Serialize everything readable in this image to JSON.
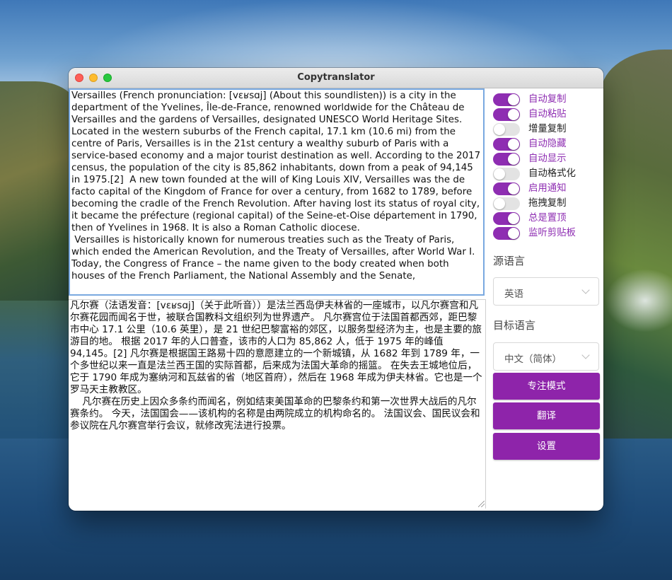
{
  "window": {
    "title": "Copytranslator"
  },
  "source_text": "Versailles (French pronunciation: [vɛʁsɑj] (About this soundlisten)) is a city in the department of the Yvelines, Île-de-France, renowned worldwide for the Château de Versailles and the gardens of Versailles, designated UNESCO World Heritage Sites. Located in the western suburbs of the French capital, 17.1 km (10.6 mi) from the centre of Paris, Versailles is in the 21st century a wealthy suburb of Paris with a service-based economy and a major tourist destination as well. According to the 2017 census, the population of the city is 85,862 inhabitants, down from a peak of 94,145 in 1975.[2]  A new town founded at the will of King Louis XIV, Versailles was the de facto capital of the Kingdom of France for over a century, from 1682 to 1789, before becoming the cradle of the French Revolution. After having lost its status of royal city, it became the préfecture (regional capital) of the Seine-et-Oise département in 1790, then of Yvelines in 1968. It is also a Roman Catholic diocese.\n Versailles is historically known for numerous treaties such as the Treaty of Paris, which ended the American Revolution, and the Treaty of Versailles, after World War I. Today, the Congress of France – the name given to the body created when both houses of the French Parliament, the National Assembly and the Senate,",
  "target_text": "凡尔赛（法语发音：[vɛʁsɑj]（关于此听音））是法兰西岛伊夫林省的一座城市，以凡尔赛宫和凡尔赛花园而闻名于世，被联合国教科文组织列为世界遗产。 凡尔赛宫位于法国首都西郊，距巴黎市中心 17.1 公里（10.6 英里），是 21 世纪巴黎富裕的郊区，以服务型经济为主，也是主要的旅游目的地。 根据 2017 年的人口普查，该市的人口为 85,862 人，低于 1975 年的峰值 94,145。[2] 凡尔赛是根据国王路易十四的意愿建立的一个新城镇，从 1682 年到 1789 年，一个多世纪以来一直是法兰西王国的实际首都，后来成为法国大革命的摇篮。 在失去王城地位后，它于 1790 年成为塞纳河和瓦兹省的省（地区首府），然后在 1968 年成为伊夫林省。它也是一个罗马天主教教区。\n    凡尔赛在历史上因众多条约而闻名，例如结束美国革命的巴黎条约和第一次世界大战后的凡尔赛条约。 今天，法国国会——该机构的名称是由两院成立的机构命名的。 法国议会、国民议会和参议院在凡尔赛宫举行会议，就修改宪法进行投票。",
  "toggles": [
    {
      "label": "自动复制",
      "on": true
    },
    {
      "label": "自动粘贴",
      "on": true
    },
    {
      "label": "增量复制",
      "on": false
    },
    {
      "label": "自动隐藏",
      "on": true
    },
    {
      "label": "自动显示",
      "on": true
    },
    {
      "label": "自动格式化",
      "on": false
    },
    {
      "label": "启用通知",
      "on": true
    },
    {
      "label": "拖拽复制",
      "on": false
    },
    {
      "label": "总是置顶",
      "on": true
    },
    {
      "label": "监听剪贴板",
      "on": true
    }
  ],
  "source_language": {
    "label": "源语言",
    "value": "英语"
  },
  "target_language": {
    "label": "目标语言",
    "value": "中文（简体）"
  },
  "buttons": {
    "focus_mode": "专注模式",
    "translate": "翻译",
    "settings": "设置"
  },
  "colors": {
    "accent": "#8e24aa",
    "toggle_on": "#8e2db2",
    "toggle_off": "#e3e3e3"
  }
}
